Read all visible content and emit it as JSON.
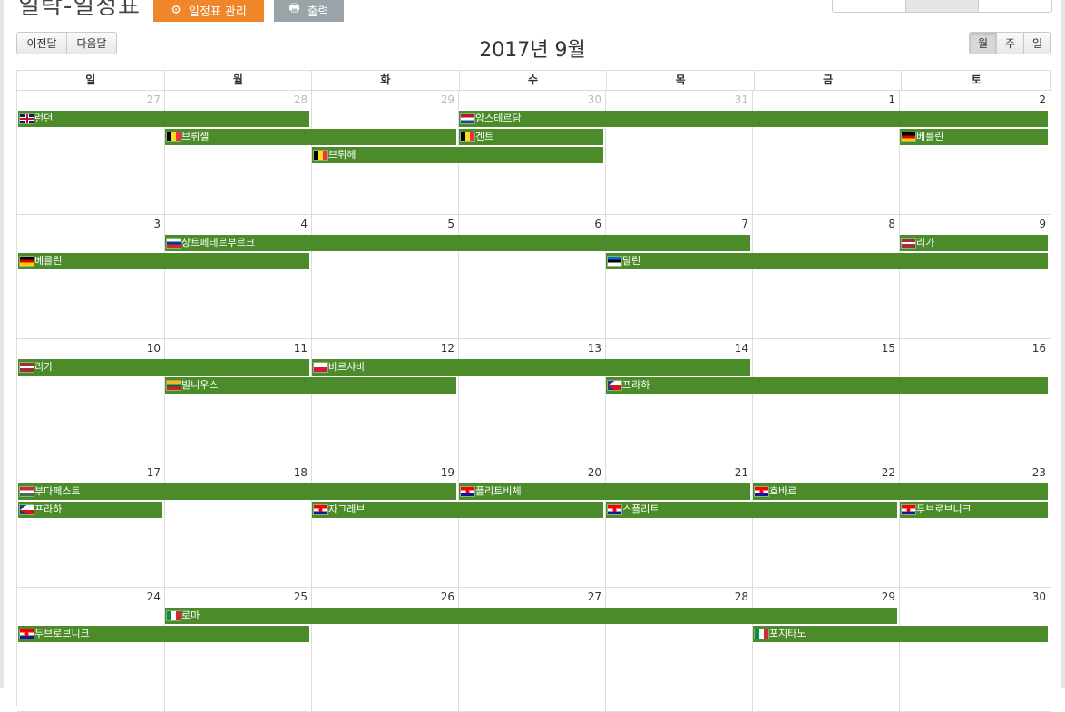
{
  "header": {
    "title": "일락-일정표",
    "manage_button": "일정표 관리",
    "print_button": "출력"
  },
  "nav": {
    "prev": "이전달",
    "next": "다음달"
  },
  "views": [
    {
      "label": "월",
      "active": true
    },
    {
      "label": "주",
      "active": false
    },
    {
      "label": "일",
      "active": false
    }
  ],
  "calendar_title": "2017년 9월",
  "weekdays": [
    "일",
    "월",
    "화",
    "수",
    "목",
    "금",
    "토"
  ],
  "weeks": [
    {
      "days": [
        {
          "num": "27",
          "other": true
        },
        {
          "num": "28",
          "other": true
        },
        {
          "num": "29",
          "other": true
        },
        {
          "num": "30",
          "other": true
        },
        {
          "num": "31",
          "other": true
        },
        {
          "num": "1",
          "other": false
        },
        {
          "num": "2",
          "other": false
        }
      ],
      "events": [
        {
          "title": "런던",
          "flag": "gb",
          "start": 0,
          "end": 1,
          "row": 0
        },
        {
          "title": "암스테르담",
          "flag": "nl",
          "start": 3,
          "end": 6,
          "row": 0
        },
        {
          "title": "브뤼셀",
          "flag": "be",
          "start": 1,
          "end": 2,
          "row": 1
        },
        {
          "title": "겐트",
          "flag": "be",
          "start": 3,
          "end": 3,
          "row": 1
        },
        {
          "title": "베를린",
          "flag": "de",
          "start": 6,
          "end": 6,
          "row": 1
        },
        {
          "title": "브뤼헤",
          "flag": "be",
          "start": 2,
          "end": 3,
          "row": 2
        }
      ]
    },
    {
      "days": [
        {
          "num": "3",
          "other": false
        },
        {
          "num": "4",
          "other": false
        },
        {
          "num": "5",
          "other": false
        },
        {
          "num": "6",
          "other": false
        },
        {
          "num": "7",
          "other": false
        },
        {
          "num": "8",
          "other": false
        },
        {
          "num": "9",
          "other": false
        }
      ],
      "events": [
        {
          "title": "상트페테르부르크",
          "flag": "ru",
          "start": 1,
          "end": 4,
          "row": 0
        },
        {
          "title": "리가",
          "flag": "lv",
          "start": 6,
          "end": 6,
          "row": 0
        },
        {
          "title": "베를린",
          "flag": "de",
          "start": 0,
          "end": 1,
          "row": 1
        },
        {
          "title": "탈린",
          "flag": "ee",
          "start": 4,
          "end": 6,
          "row": 1
        }
      ]
    },
    {
      "days": [
        {
          "num": "10",
          "other": false
        },
        {
          "num": "11",
          "other": false
        },
        {
          "num": "12",
          "other": false
        },
        {
          "num": "13",
          "other": false
        },
        {
          "num": "14",
          "other": false
        },
        {
          "num": "15",
          "other": false
        },
        {
          "num": "16",
          "other": false
        }
      ],
      "events": [
        {
          "title": "리가",
          "flag": "lv",
          "start": 0,
          "end": 1,
          "row": 0
        },
        {
          "title": "바르샤바",
          "flag": "pl",
          "start": 2,
          "end": 4,
          "row": 0
        },
        {
          "title": "빌니우스",
          "flag": "lt",
          "start": 1,
          "end": 2,
          "row": 1
        },
        {
          "title": "프라하",
          "flag": "cz",
          "start": 4,
          "end": 6,
          "row": 1
        }
      ]
    },
    {
      "days": [
        {
          "num": "17",
          "other": false
        },
        {
          "num": "18",
          "other": false
        },
        {
          "num": "19",
          "other": false
        },
        {
          "num": "20",
          "other": false
        },
        {
          "num": "21",
          "other": false
        },
        {
          "num": "22",
          "other": false
        },
        {
          "num": "23",
          "other": false
        }
      ],
      "events": [
        {
          "title": "부다페스트",
          "flag": "hu",
          "start": 0,
          "end": 2,
          "row": 0
        },
        {
          "title": "플리트비체",
          "flag": "hr",
          "start": 3,
          "end": 4,
          "row": 0
        },
        {
          "title": "흐바르",
          "flag": "hr",
          "start": 5,
          "end": 6,
          "row": 0
        },
        {
          "title": "프라하",
          "flag": "cz",
          "start": 0,
          "end": 0,
          "row": 1
        },
        {
          "title": "자그레브",
          "flag": "hr",
          "start": 2,
          "end": 3,
          "row": 1
        },
        {
          "title": "스플리트",
          "flag": "hr",
          "start": 4,
          "end": 5,
          "row": 1
        },
        {
          "title": "두브로브니크",
          "flag": "hr",
          "start": 6,
          "end": 6,
          "row": 1
        }
      ]
    },
    {
      "days": [
        {
          "num": "24",
          "other": false
        },
        {
          "num": "25",
          "other": false
        },
        {
          "num": "26",
          "other": false
        },
        {
          "num": "27",
          "other": false
        },
        {
          "num": "28",
          "other": false
        },
        {
          "num": "29",
          "other": false
        },
        {
          "num": "30",
          "other": false
        }
      ],
      "events": [
        {
          "title": "로마",
          "flag": "it",
          "start": 1,
          "end": 5,
          "row": 0
        },
        {
          "title": "두브로브니크",
          "flag": "hr",
          "start": 0,
          "end": 1,
          "row": 1
        },
        {
          "title": "포지타노",
          "flag": "it",
          "start": 5,
          "end": 6,
          "row": 1
        }
      ]
    }
  ],
  "event_color": "#4b8b2a",
  "flags": {
    "gb": {
      "name": "uk-flag-icon",
      "css": "linear-gradient(#c8102e,#c8102e) 50% 50%/100% 2px no-repeat, linear-gradient(#c8102e,#c8102e) 50% 50%/2px 100% no-repeat, linear-gradient(#fff,#fff) 50% 50%/100% 4px no-repeat, linear-gradient(#fff,#fff) 50% 50%/4px 100% no-repeat, #012169"
    },
    "nl": {
      "name": "netherlands-flag-icon",
      "css": "linear-gradient(#ae1c28 0 33%, #ffffff 33% 66%, #21468b 66% 100%)"
    },
    "be": {
      "name": "belgium-flag-icon",
      "css": "linear-gradient(90deg,#000 0 33%, #fdda24 33% 66%, #ef3340 66% 100%)"
    },
    "de": {
      "name": "germany-flag-icon",
      "css": "linear-gradient(#000 0 33%, #dd0000 33% 66%, #ffce00 66% 100%)"
    },
    "ru": {
      "name": "russia-flag-icon",
      "css": "linear-gradient(#ffffff 0 33%, #0039a6 33% 66%, #d52b1e 66% 100%)"
    },
    "lv": {
      "name": "latvia-flag-icon",
      "css": "linear-gradient(#9e3039 0 40%, #ffffff 40% 60%, #9e3039 60% 100%)"
    },
    "ee": {
      "name": "estonia-flag-icon",
      "css": "linear-gradient(#0072ce 0 33%, #000000 33% 66%, #ffffff 66% 100%)"
    },
    "pl": {
      "name": "poland-flag-icon",
      "css": "linear-gradient(#ffffff 0 50%, #dc143c 50% 100%)"
    },
    "lt": {
      "name": "lithuania-flag-icon",
      "css": "linear-gradient(#fdb913 0 33%, #006a44 33% 66%, #c1272d 66% 100%)"
    },
    "cz": {
      "name": "czech-flag-icon",
      "css": "linear-gradient(to bottom right, #11457e 0 50%, transparent 50%) 0 0/50% 50% no-repeat, linear-gradient(to top right, #11457e 0 50%, transparent 50%) 0 100%/50% 50% no-repeat, linear-gradient(#ffffff 0 50%, #d7141a 50% 100%)"
    },
    "hu": {
      "name": "hungary-flag-icon",
      "css": "linear-gradient(#cd2a3e 0 33%, #ffffff 33% 66%, #436f4d 66% 100%)"
    },
    "hr": {
      "name": "croatia-flag-icon",
      "css": "radial-gradient(circle at 50% 50%, #ff0000 0 2px, transparent 2px), linear-gradient(#ff0000 0 33%, #ffffff 33% 66%, #171796 66% 100%)"
    },
    "it": {
      "name": "italy-flag-icon",
      "css": "linear-gradient(90deg,#009246 0 33%, #ffffff 33% 66%, #ce2b37 66% 100%)"
    }
  }
}
